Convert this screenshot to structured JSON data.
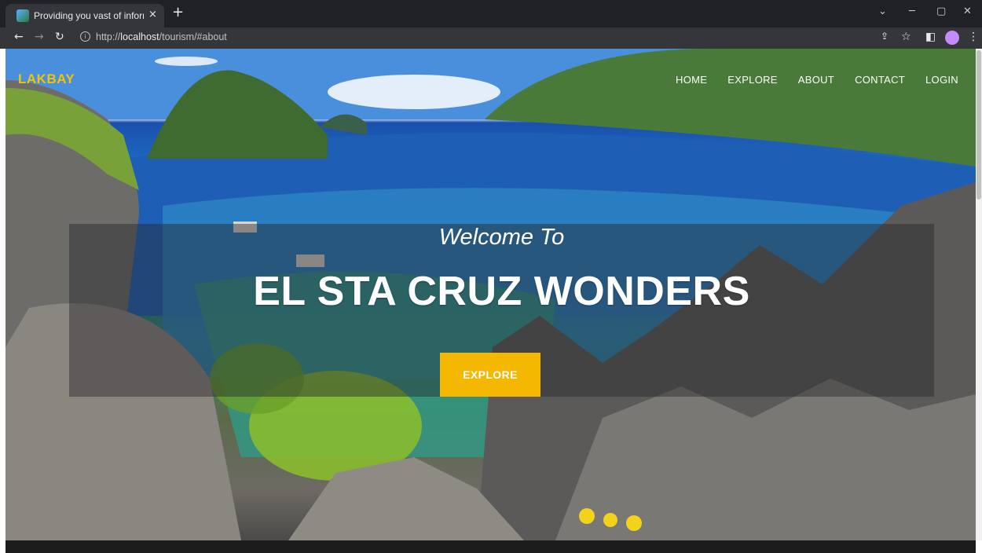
{
  "browser": {
    "tab_title": "Providing you vast of information",
    "tab_close": "×",
    "new_tab": "+",
    "url_host": "localhost",
    "url_prefix": "http://",
    "url_path": "/tourism/#about",
    "window_controls": {
      "minimize": "─",
      "restore": "▢",
      "close": "✕",
      "dropdown": "⌄"
    }
  },
  "site": {
    "brand": "LAKBAY",
    "nav": [
      "HOME",
      "EXPLORE",
      "ABOUT",
      "CONTACT",
      "LOGIN"
    ]
  },
  "hero": {
    "welcome": "Welcome To",
    "headline": "EL STA CRUZ WONDERS",
    "button": "EXPLORE"
  },
  "colors": {
    "brand": "#f5c400",
    "button": "#f5b800",
    "chrome_dark": "#202124",
    "chrome_toolbar": "#35363a"
  }
}
